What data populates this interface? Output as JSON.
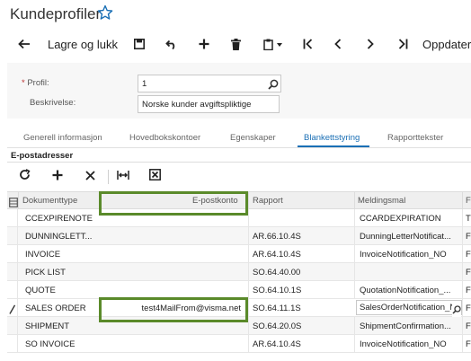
{
  "page": {
    "title": "Kundeprofiler"
  },
  "toolbar": {
    "save_close_label": "Lagre og lukk",
    "update_label": "Oppdater"
  },
  "form": {
    "profile_label": "Profil:",
    "profile_required_mark": "*",
    "profile_value": "1",
    "description_label": "Beskrivelse:",
    "description_value": "Norske kunder avgiftspliktige"
  },
  "tabs": [
    {
      "label": "Generell informasjon",
      "active": false
    },
    {
      "label": "Hovedbokskontoer",
      "active": false
    },
    {
      "label": "Egenskaper",
      "active": false
    },
    {
      "label": "Blankettstyring",
      "active": true
    },
    {
      "label": "Rapporttekster",
      "active": false
    }
  ],
  "section": {
    "title": "E-postadresser"
  },
  "grid": {
    "columns": [
      "Dokumenttype",
      "E-postkonto",
      "Rapport",
      "Meldingsmal",
      "F"
    ],
    "rows": [
      {
        "doc_type": "CCEXPIRENOTE",
        "email": "",
        "report": "",
        "template": "CCARDEXPIRATION",
        "f": "T"
      },
      {
        "doc_type": "DUNNINGLETT...",
        "email": "",
        "report": "AR.66.10.4S",
        "template": "DunningLetterNotificat...",
        "f": "F"
      },
      {
        "doc_type": "INVOICE",
        "email": "",
        "report": "AR.64.10.4S",
        "template": "InvoiceNotification_NO",
        "f": "F"
      },
      {
        "doc_type": "PICK LIST",
        "email": "",
        "report": "SO.64.40.00",
        "template": "",
        "f": "F"
      },
      {
        "doc_type": "QUOTE",
        "email": "",
        "report": "SO.64.10.1S",
        "template": "QuotationNotification_...",
        "f": "F"
      },
      {
        "doc_type": "SALES ORDER",
        "email": "test4MailFrom@visma.net",
        "report": "SO.64.11.1S",
        "template": "SalesOrderNotification_N",
        "f": "F"
      },
      {
        "doc_type": "SHIPMENT",
        "email": "",
        "report": "SO.64.20.0S",
        "template": "ShipmentConfirmation...",
        "f": "F"
      },
      {
        "doc_type": "SO INVOICE",
        "email": "",
        "report": "AR.64.10.4S",
        "template": "InvoiceNotification_NO",
        "f": "F"
      }
    ]
  },
  "icons": {
    "star": "star-icon",
    "back": "arrow-left-icon",
    "save": "save-icon",
    "undo": "undo-icon",
    "add": "plus-icon",
    "delete": "trash-icon",
    "copy_paste": "clipboard-icon",
    "first": "first-page-icon",
    "prev": "chevron-left-icon",
    "next": "chevron-right-icon",
    "last": "last-page-icon",
    "refresh": "refresh-icon",
    "remove": "close-icon",
    "fit_width": "fit-width-icon",
    "export_excel": "excel-icon",
    "search": "search-icon",
    "edit": "pencil-icon"
  },
  "colors": {
    "accent": "#1a6fb5",
    "highlight_box": "#5a8a2a"
  }
}
